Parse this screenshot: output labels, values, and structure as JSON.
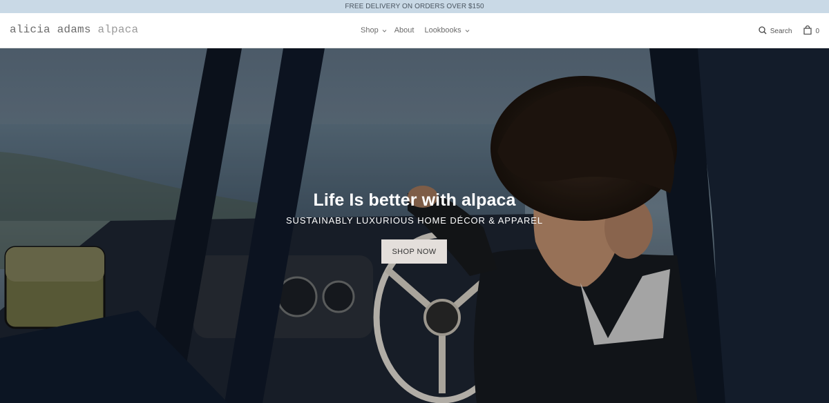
{
  "announcement": {
    "text": "FREE DELIVERY ON ORDERS OVER $150"
  },
  "header": {
    "logo_main": "alicia adams",
    "logo_light": "alpaca",
    "nav": [
      {
        "label": "Shop",
        "has_dropdown": true
      },
      {
        "label": "About",
        "has_dropdown": false
      },
      {
        "label": "Lookbooks",
        "has_dropdown": true
      }
    ],
    "search_label": "Search",
    "cart_count": "0",
    "icons": {
      "search": "search-icon",
      "cart": "shopping-bag-icon",
      "dropdown": "chevron-down-icon"
    }
  },
  "hero": {
    "title": "Life Is better with alpaca",
    "subtitle": "SUSTAINABLY LUXURIOUS HOME DÉCOR & APPAREL",
    "button_label": "SHOP NOW",
    "image_subject": "man with curly hair sitting in a vintage car by the ocean"
  },
  "colors": {
    "announcement_bg": "#c9d9e6",
    "button_bg": "#e4dfdb",
    "header_bg": "#ffffff"
  }
}
